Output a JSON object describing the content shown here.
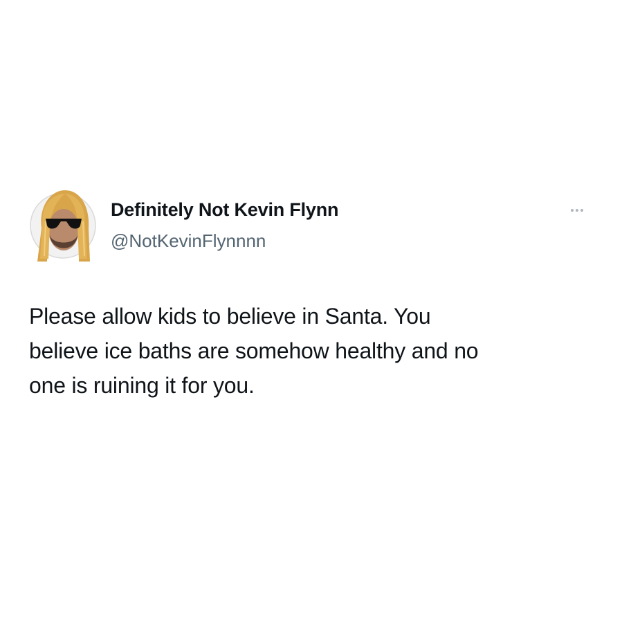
{
  "author": {
    "display_name": "Definitely Not Kevin Flynn",
    "handle": "@NotKevinFlynnnn",
    "avatar_icon": "avatar-sunglasses-long-hair"
  },
  "more_menu": {
    "icon": "more-horizontal-icon"
  },
  "tweet": {
    "lines": [
      "Please allow kids to believe in Santa. You",
      "believe ice baths are somehow healthy and no",
      "one is ruining it for you."
    ]
  },
  "colors": {
    "text_primary": "#0f1419",
    "text_secondary": "#536471",
    "background": "#ffffff"
  }
}
